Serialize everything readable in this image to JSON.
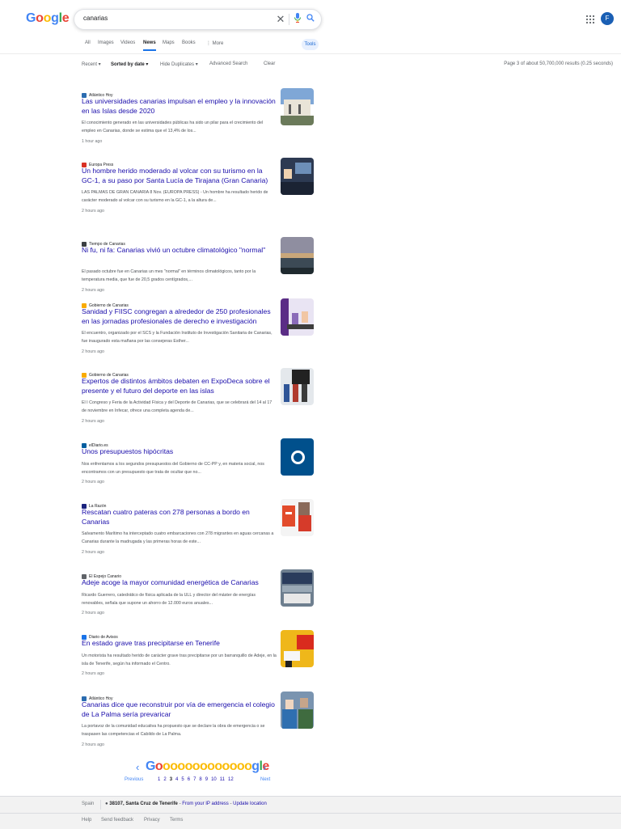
{
  "header": {
    "logo_letters": [
      {
        "ch": "G",
        "color": "#4285f4"
      },
      {
        "ch": "o",
        "color": "#ea4335"
      },
      {
        "ch": "o",
        "color": "#fbbc05"
      },
      {
        "ch": "g",
        "color": "#4285f4"
      },
      {
        "ch": "l",
        "color": "#34a853"
      },
      {
        "ch": "e",
        "color": "#ea4335"
      }
    ],
    "search_query": "canarias",
    "avatar_letter": "F",
    "tabs": [
      {
        "label": "All",
        "active": false
      },
      {
        "label": "Images",
        "active": false
      },
      {
        "label": "Videos",
        "active": false
      },
      {
        "label": "News",
        "active": true
      },
      {
        "label": "Maps",
        "active": false
      },
      {
        "label": "Books",
        "active": false
      },
      {
        "label": "⋮ More",
        "active": false
      }
    ],
    "tools_label": "Tools"
  },
  "filters": {
    "recent": "Recent ▾",
    "sorted": "Sorted by date ▾",
    "duplicates": "Hide Duplicates ▾",
    "advanced": "Advanced Search",
    "clear": "Clear",
    "result_stats": "Page 3 of about 50,700,000 results (0.25 seconds)"
  },
  "results": [
    {
      "source": "Atlántico Hoy",
      "source_color": "#2b6cb0",
      "title": "Las universidades canarias impulsan el empleo y la innovación en las Islas desde 2020",
      "snippet": "El conocimiento generado en las universidades públicas ha sido un pilar para el crecimiento del empleo en Canarias, donde se estima que el 13,4% de los...",
      "time": "1 hour ago",
      "thumb": "building"
    },
    {
      "source": "Europa Press",
      "source_color": "#d93025",
      "title": "Un hombre herido moderado al volcar con su turismo en la GC-1, a su paso por Santa Lucía de Tirajana (Gran Canaria)",
      "snippet": "LAS PALMAS DE GRAN CANARIA 8 Nov. (EUROPA PRESS) - Un hombre ha resultado herido de carácter moderado al volcar con su turismo en la GC-1, a la altura de...",
      "time": "2 hours ago",
      "thumb": "office"
    },
    {
      "source": "Tiempo de Canarias",
      "source_color": "#3c4043",
      "title": "Ni fu, ni fa: Canarias vivió un octubre climatológico \"normal\"",
      "snippet": "El pasado octubre fue en Canarias un mes \"normal\" en términos climatológicos, tanto por la temperatura media, que fue de 20,5 grados centígrados,...",
      "time": "2 hours ago",
      "thumb": "coast"
    },
    {
      "source": "Gobierno de Canarias",
      "source_color": "#f9ab00",
      "title": "Sanidad y FIISC congregan a alrededor de 250 profesionales en las jornadas profesionales de derecho e investigación",
      "snippet": "El encuentro, organizado por el SCS y la Fundación Instituto de Investigación Sanitaria de Canarias, fue inaugurado esta mañana por las consejeras Esther...",
      "time": "2 hours ago",
      "thumb": "panel"
    },
    {
      "source": "Gobierno de Canarias",
      "source_color": "#f9ab00",
      "title": "Expertos de distintos ámbitos debaten en ExpoDeca sobre el presente y el futuro del deporte en las islas",
      "snippet": "El I Congreso y Feria de la Actividad Física y del Deporte de Canarias, que se celebrará del 14 al 17 de noviembre en Infecar, ofrece una completa agenda de...",
      "time": "2 hours ago",
      "thumb": "people"
    },
    {
      "source": "elDiario.es",
      "source_color": "#005d9f",
      "title": "Unos presupuestos hipócritas",
      "snippet": "Nos enfrentamos a los segundos presupuestos del Gobierno de CC-PP y, en materia social, nos encontramos con un presupuesto que trata de ocultar que no...",
      "time": "2 hours ago",
      "thumb": "eldiario"
    },
    {
      "source": "La Razón",
      "source_color": "#1a237e",
      "title": "Rescatan cuatro pateras con 278 personas a bordo en Canarias",
      "snippet": "Salvamento Marítimo ha interceptado cuatro embarcaciones con 278 migrantes en aguas cercanas a Canarias durante la madrugada y las primeras horas de este...",
      "time": "2 hours ago",
      "thumb": "rescue"
    },
    {
      "source": "El Espejo Canario",
      "source_color": "#5f6368",
      "title": "Adeje acoge la mayor comunidad energética de Canarias",
      "snippet": "Ricardo Guerrero, catedrático de física aplicada de la ULL y director del máster de energías renovables, señala que supone un ahorro de 12.000 euros anuales...",
      "time": "2 hours ago",
      "thumb": "solar"
    },
    {
      "source": "Diario de Avisos",
      "source_color": "#1a73e8",
      "title": "En estado grave tras precipitarse en Tenerife",
      "snippet": "Un motorista ha resultado herido de carácter grave tras precipitarse por un barranquillo de Adeje, en la isla de Tenerife, según ha informado el Centro.",
      "time": "2 hours ago",
      "thumb": "ambulance"
    },
    {
      "source": "Atlántico Hoy",
      "source_color": "#2b6cb0",
      "title": "Canarias dice que reconstruir por vía de emergencia el colegio de La Palma sería prevaricar",
      "snippet": "La portavoz de la comunidad educativa ha propuesto que se declare la obra de emergencia o se traspasen las competencias el Cabildo de La Palma.",
      "time": "2 hours ago",
      "thumb": "school"
    }
  ],
  "pagination": {
    "logo_letters": [
      {
        "ch": "G",
        "color": "#4285f4"
      },
      {
        "ch": "o",
        "color": "#ea4335"
      },
      {
        "ch": "o",
        "color": "#fbbc05"
      },
      {
        "ch": "o",
        "color": "#fbbc05"
      },
      {
        "ch": "o",
        "color": "#fbbc05"
      },
      {
        "ch": "o",
        "color": "#fbbc05"
      },
      {
        "ch": "o",
        "color": "#fbbc05"
      },
      {
        "ch": "o",
        "color": "#fbbc05"
      },
      {
        "ch": "o",
        "color": "#fbbc05"
      },
      {
        "ch": "o",
        "color": "#fbbc05"
      },
      {
        "ch": "o",
        "color": "#fbbc05"
      },
      {
        "ch": "o",
        "color": "#fbbc05"
      },
      {
        "ch": "o",
        "color": "#fbbc05"
      },
      {
        "ch": "o",
        "color": "#fbbc05"
      },
      {
        "ch": "g",
        "color": "#4285f4"
      },
      {
        "ch": "l",
        "color": "#34a853"
      },
      {
        "ch": "e",
        "color": "#ea4335"
      }
    ],
    "previous": "Previous",
    "next": "Next",
    "pages": [
      "1",
      "2",
      "3",
      "4",
      "5",
      "6",
      "7",
      "8",
      "9",
      "10",
      "11",
      "12"
    ],
    "current_page": "3"
  },
  "footer": {
    "country": "Spain",
    "location": "38107, Santa Cruz de Tenerife",
    "from_ip": "From your IP address",
    "update_location": "Update location",
    "links": [
      "Help",
      "Send feedback",
      "Privacy",
      "Terms"
    ]
  }
}
